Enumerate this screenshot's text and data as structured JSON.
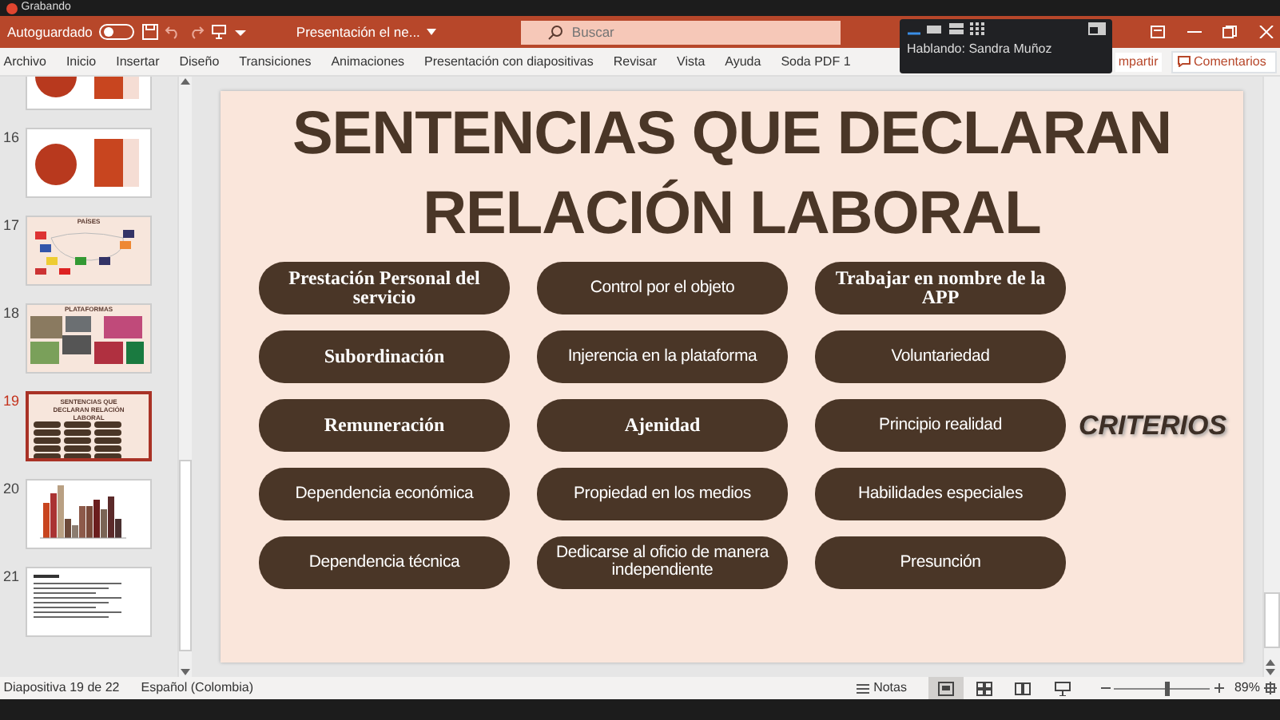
{
  "recording": {
    "label": "Grabando"
  },
  "title_bar": {
    "autosave_label": "Autoguardado",
    "autosave_on": false,
    "document_title": "Presentación el ne...",
    "search_placeholder": "Buscar"
  },
  "ribbon_tabs": [
    "Archivo",
    "Inicio",
    "Insertar",
    "Diseño",
    "Transiciones",
    "Animaciones",
    "Presentación con diapositivas",
    "Revisar",
    "Vista",
    "Ayuda",
    "Soda PDF 1"
  ],
  "share_button": "mpartir",
  "comments_button": "Comentarios",
  "call_popup": {
    "status": "Hablando: Sandra Muñoz"
  },
  "thumbnails": [
    {
      "kind": "table",
      "selected": false
    },
    {
      "number": "16",
      "kind": "table",
      "selected": false
    },
    {
      "number": "17",
      "kind": "map",
      "title": "PAÍSES",
      "selected": false
    },
    {
      "number": "18",
      "kind": "photos",
      "title": "PLATAFORMAS",
      "selected": false
    },
    {
      "number": "19",
      "kind": "criteria",
      "title": "SENTENCIAS QUE DECLARAN RELACIÓN LABORAL",
      "selected": true
    },
    {
      "number": "20",
      "kind": "chart",
      "selected": false
    },
    {
      "number": "21",
      "kind": "text",
      "selected": false
    }
  ],
  "slide": {
    "title_lines": [
      "SENTENCIAS QUE DECLARAN",
      "RELACIÓN LABORAL"
    ],
    "criteria": [
      {
        "text": "Prestación Personal del servicio",
        "kind": "serif"
      },
      {
        "text": "Control por el objeto",
        "kind": "sans"
      },
      {
        "text": "Trabajar en nombre de la APP",
        "kind": "serif"
      },
      {
        "text": "Subordinación",
        "kind": "serif"
      },
      {
        "text": "Injerencia en la plataforma",
        "kind": "sans"
      },
      {
        "text": "Voluntariedad",
        "kind": "sans"
      },
      {
        "text": "Remuneración",
        "kind": "serif"
      },
      {
        "text": "Ajenidad",
        "kind": "serif"
      },
      {
        "text": "Principio realidad",
        "kind": "sans"
      },
      {
        "text": "Dependencia económica",
        "kind": "sans"
      },
      {
        "text": "Propiedad en los medios",
        "kind": "sans"
      },
      {
        "text": "Habilidades especiales",
        "kind": "sans"
      },
      {
        "text": "Dependencia técnica",
        "kind": "sans"
      },
      {
        "text": "Dedicarse al oficio de manera independiente",
        "kind": "sans"
      },
      {
        "text": "Presunción",
        "kind": "sans"
      }
    ],
    "side_label": "CRITERIOS"
  },
  "status_bar": {
    "slide_counter": "Diapositiva 19 de 22",
    "language": "Español (Colombia)",
    "notes": "Notas",
    "views": [
      {
        "selected": true
      },
      {
        "selected": false
      },
      {
        "selected": false
      },
      {
        "selected": false
      }
    ],
    "zoom": {
      "level": 0.55
    },
    "zoom_percent": "89%"
  }
}
